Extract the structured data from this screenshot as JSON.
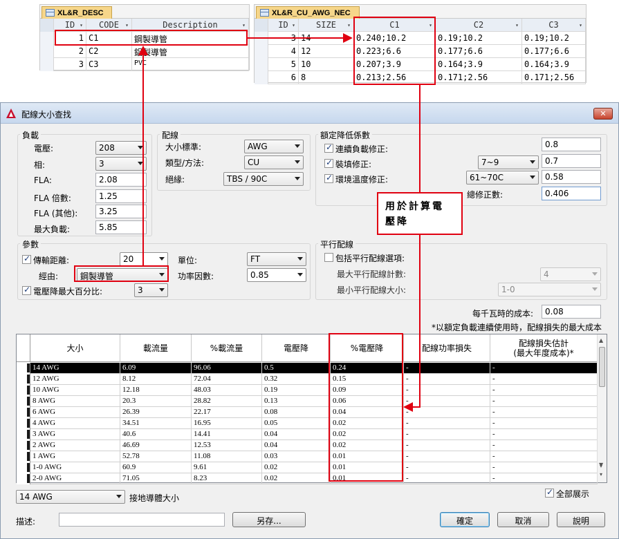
{
  "desc_table": {
    "tab": "XL&R_DESC",
    "headers": [
      "ID",
      "CODE",
      "Description"
    ],
    "rows": [
      [
        "1",
        "C1",
        "鋼製導管"
      ],
      [
        "2",
        "C2",
        "鋁製導管"
      ],
      [
        "3",
        "C3",
        "PVC"
      ]
    ]
  },
  "awg_table": {
    "tab": "XL&R_CU_AWG_NEC",
    "headers": [
      "ID",
      "SIZE",
      "C1",
      "C2",
      "C3"
    ],
    "rows": [
      [
        "3",
        "14",
        "0.240;10.2",
        "0.19;10.2",
        "0.19;10.2"
      ],
      [
        "4",
        "12",
        "0.223;6.6",
        "0.177;6.6",
        "0.177;6.6"
      ],
      [
        "5",
        "10",
        "0.207;3.9",
        "0.164;3.9",
        "0.164;3.9"
      ],
      [
        "6",
        "8",
        "0.213;2.56",
        "0.171;2.56",
        "0.171;2.56"
      ]
    ]
  },
  "dialog": {
    "title": "配線大小查找",
    "load": {
      "label": "負載",
      "voltage_label": "電壓:",
      "voltage": "208",
      "phase_label": "相:",
      "phase": "3",
      "fla_label": "FLA:",
      "fla": "2.08",
      "fla_mult_label": "FLA 倍數:",
      "fla_mult": "1.25",
      "fla_other_label": "FLA (其他):",
      "fla_other": "3.25",
      "max_load_label": "最大負載:",
      "max_load": "5.85"
    },
    "wiring": {
      "label": "配線",
      "size_std_label": "大小標準:",
      "size_std": "AWG",
      "type_label": "類型/方法:",
      "type": "CU",
      "insulation_label": "絕緣:",
      "insulation": "TBS / 90C"
    },
    "derate": {
      "label": "額定降低係數",
      "continuous_label": "連續負載修正:",
      "continuous": "0.8",
      "fill_label": "裝填修正:",
      "fill_sel": "7~9",
      "fill": "0.7",
      "ambient_label": "環境溫度修正:",
      "ambient_sel": "61~70C",
      "ambient": "0.58",
      "total_label": "總修正數:",
      "total": "0.406"
    },
    "params": {
      "label": "參數",
      "distance_label": "傳輸距離:",
      "distance": "20",
      "unit_label": "單位:",
      "unit": "FT",
      "via_label": "經由:",
      "via": "鋼製導管",
      "pf_label": "功率因數:",
      "pf": "0.85",
      "vd_label": "電壓降最大百分比:",
      "vd": "3"
    },
    "parallel": {
      "label": "平行配線",
      "include_label": "包括平行配線選項:",
      "max_count_label": "最大平行配線計數:",
      "max_count": "4",
      "min_size_label": "最小平行配線大小:",
      "min_size": "1-0"
    },
    "cost_label": "每千瓦時的成本:",
    "cost": "0.08",
    "note": "*以額定負載連續使用時，配線損失的最大成本",
    "grid": {
      "headers": [
        "大小",
        "載流量",
        "%載流量",
        "電壓降",
        "%電壓降",
        "配線功率損失",
        "配線損失估計\n(最大年度成本)*"
      ],
      "rows": [
        [
          "14 AWG",
          "6.09",
          "96.06",
          "0.5",
          "0.24",
          "-",
          "-"
        ],
        [
          "12 AWG",
          "8.12",
          "72.04",
          "0.32",
          "0.15",
          "-",
          "-"
        ],
        [
          "10 AWG",
          "12.18",
          "48.03",
          "0.19",
          "0.09",
          "-",
          "-"
        ],
        [
          "8 AWG",
          "20.3",
          "28.82",
          "0.13",
          "0.06",
          "-",
          "-"
        ],
        [
          "6 AWG",
          "26.39",
          "22.17",
          "0.08",
          "0.04",
          "-",
          "-"
        ],
        [
          "4 AWG",
          "34.51",
          "16.95",
          "0.05",
          "0.02",
          "-",
          "-"
        ],
        [
          "3 AWG",
          "40.6",
          "14.41",
          "0.04",
          "0.02",
          "-",
          "-"
        ],
        [
          "2 AWG",
          "46.69",
          "12.53",
          "0.04",
          "0.02",
          "-",
          "-"
        ],
        [
          "1 AWG",
          "52.78",
          "11.08",
          "0.03",
          "0.01",
          "-",
          "-"
        ],
        [
          "1-0 AWG",
          "60.9",
          "9.61",
          "0.02",
          "0.01",
          "-",
          "-"
        ],
        [
          "2-0 AWG",
          "71.05",
          "8.23",
          "0.02",
          "0.01",
          "-",
          "-"
        ]
      ]
    },
    "ground_size": "14 AWG",
    "ground_label": "接地導體大小",
    "show_all_label": "全部展示",
    "desc_label": "描述:",
    "desc_value": "",
    "save_as": "另存...",
    "ok": "確定",
    "cancel": "取消",
    "help": "說明"
  },
  "callout": "用於計算電壓降",
  "colors": {
    "annotation": "#e00010",
    "selected_row": "#000000"
  }
}
